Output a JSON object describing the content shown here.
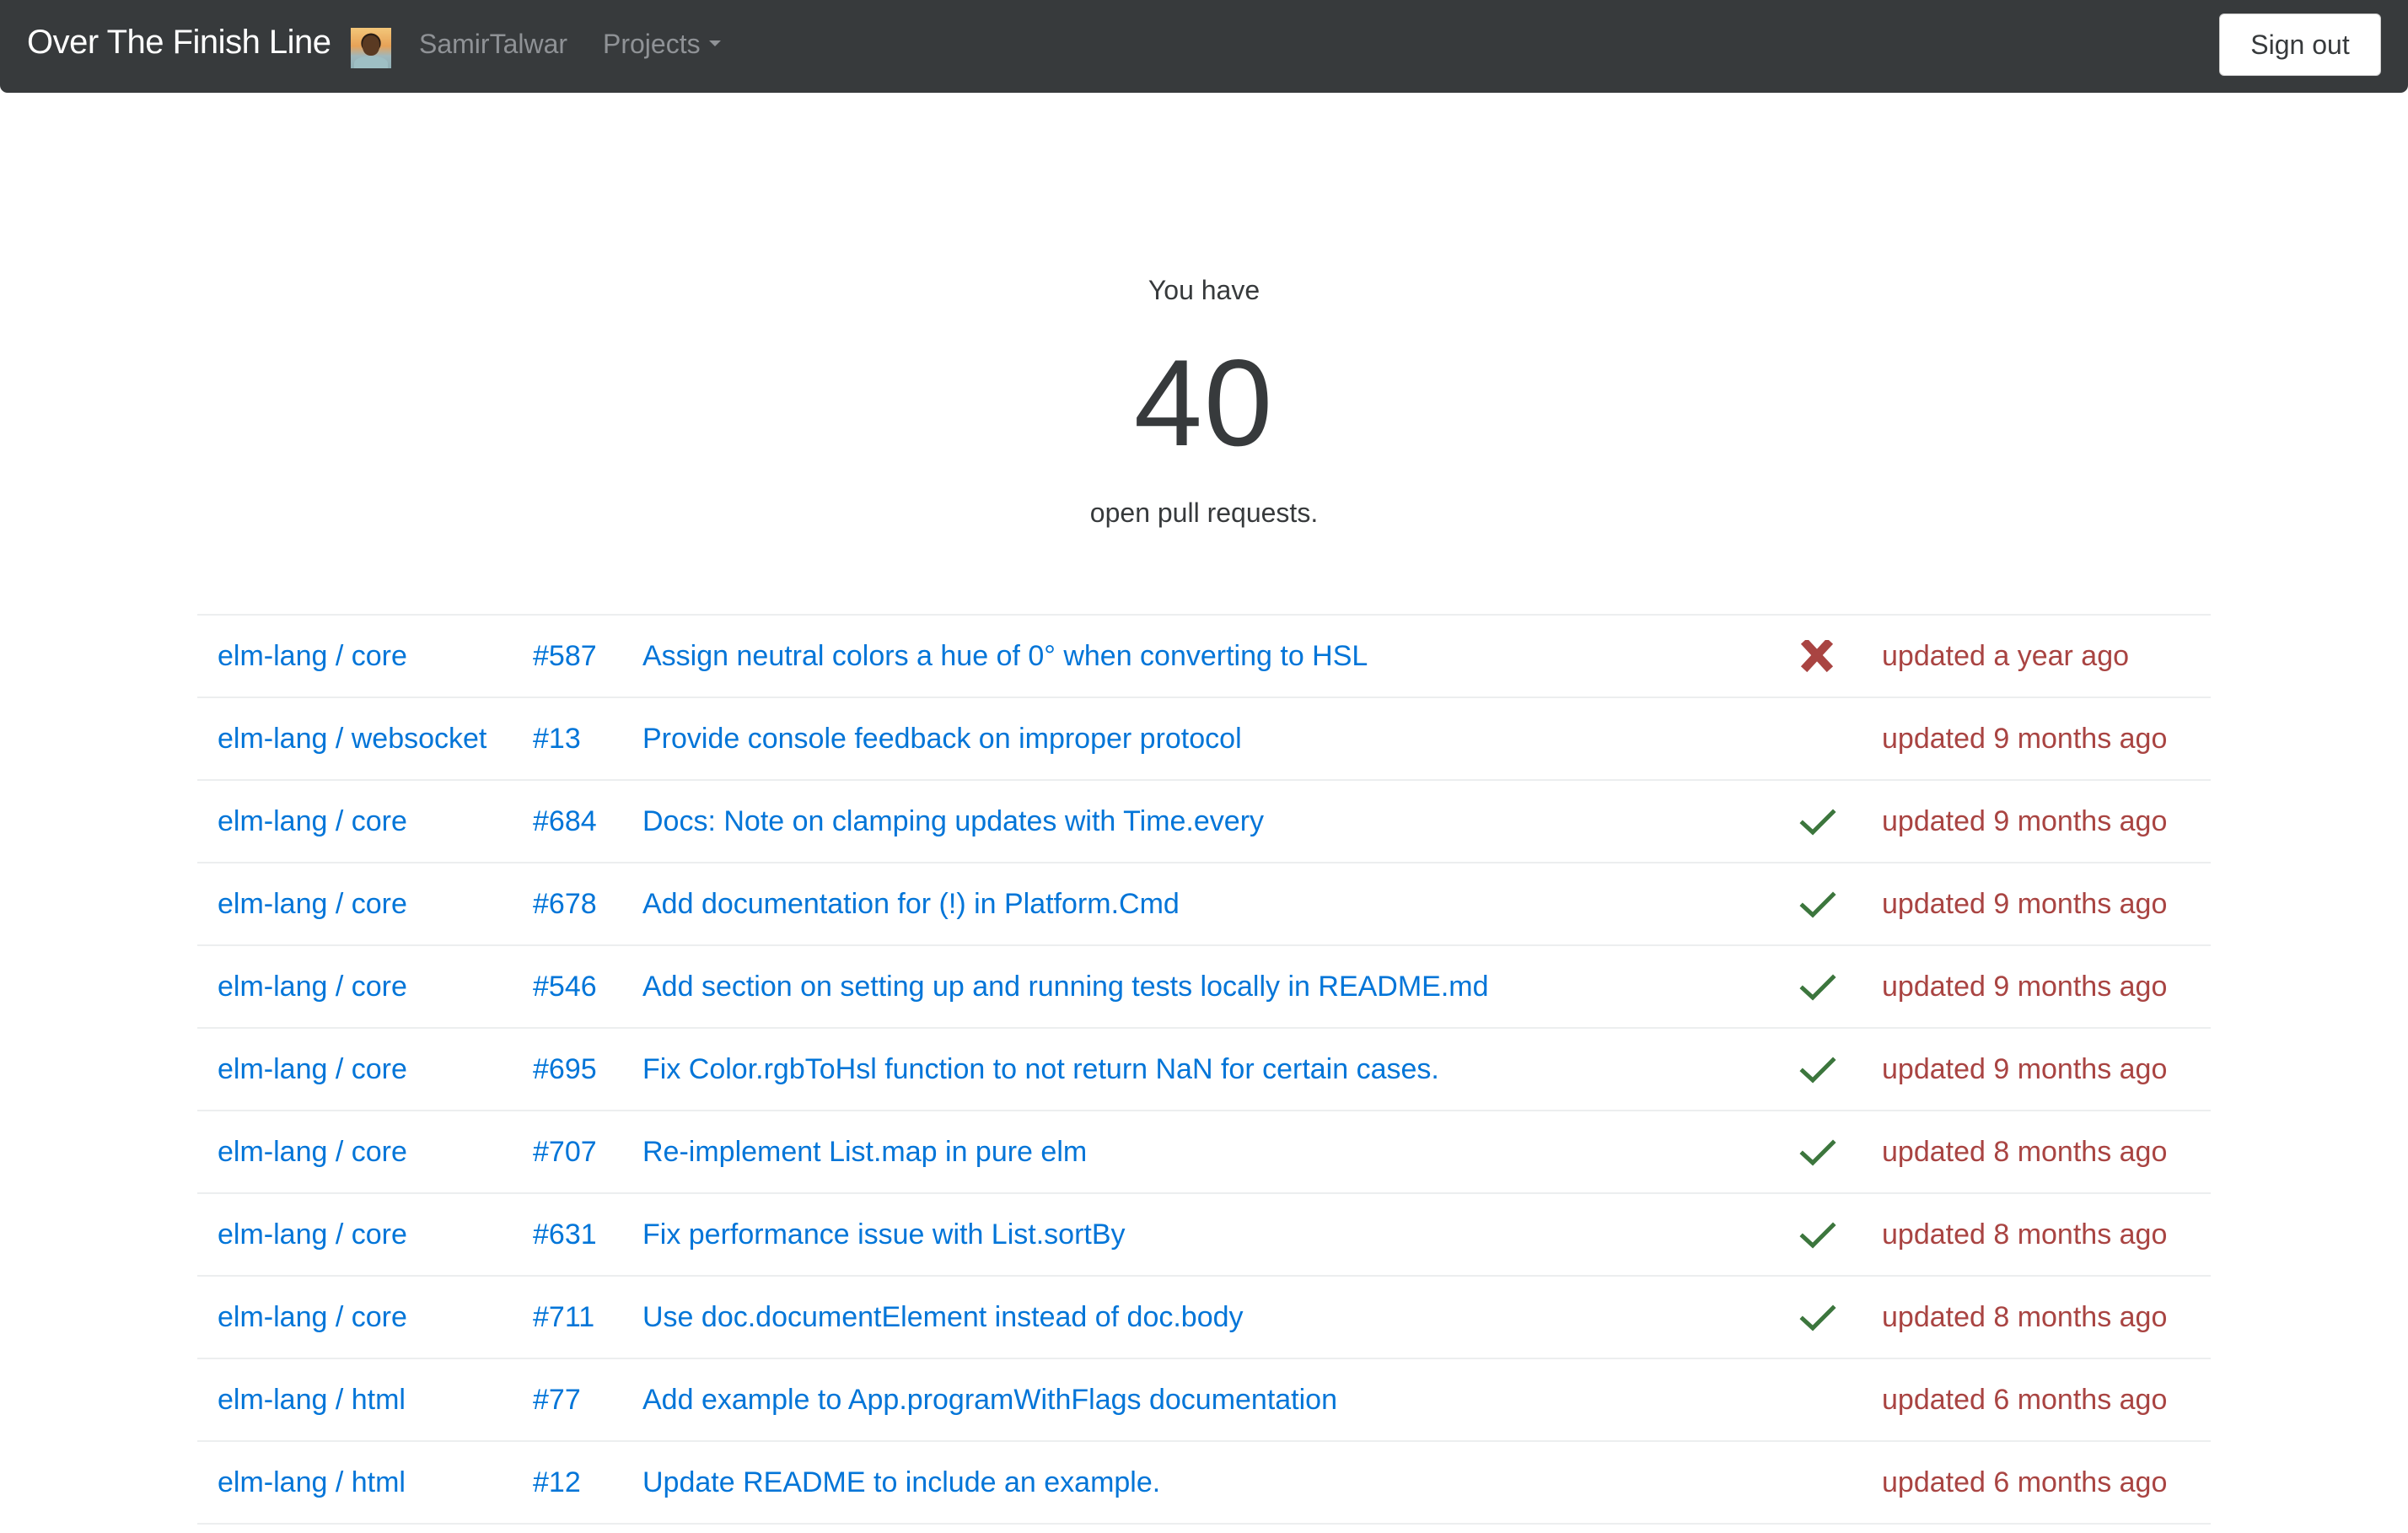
{
  "navbar": {
    "brand": "Over The Finish Line",
    "user": "SamirTalwar",
    "projects_label": "Projects",
    "sign_out_label": "Sign out"
  },
  "hero": {
    "prefix": "You have",
    "count": "40",
    "suffix": "open pull requests."
  },
  "colors": {
    "navbar_bg": "#373a3c",
    "link": "#0275d8",
    "time": "#a94442",
    "success": "#3c763d",
    "failure": "#a94442"
  },
  "pull_requests": [
    {
      "repo": "elm-lang / core",
      "number": "#587",
      "title": "Assign neutral colors a hue of 0° when converting to HSL",
      "status": "failure",
      "status_icon": "cross-icon",
      "updated": "updated a year ago"
    },
    {
      "repo": "elm-lang / websocket",
      "number": "#13",
      "title": "Provide console feedback on improper protocol",
      "status": "none",
      "status_icon": "",
      "updated": "updated 9 months ago"
    },
    {
      "repo": "elm-lang / core",
      "number": "#684",
      "title": "Docs: Note on clamping updates with Time.every",
      "status": "success",
      "status_icon": "check-icon",
      "updated": "updated 9 months ago"
    },
    {
      "repo": "elm-lang / core",
      "number": "#678",
      "title": "Add documentation for (!) in Platform.Cmd",
      "status": "success",
      "status_icon": "check-icon",
      "updated": "updated 9 months ago"
    },
    {
      "repo": "elm-lang / core",
      "number": "#546",
      "title": "Add section on setting up and running tests locally in README.md",
      "status": "success",
      "status_icon": "check-icon",
      "updated": "updated 9 months ago"
    },
    {
      "repo": "elm-lang / core",
      "number": "#695",
      "title": "Fix Color.rgbToHsl function to not return NaN for certain cases.",
      "status": "success",
      "status_icon": "check-icon",
      "updated": "updated 9 months ago"
    },
    {
      "repo": "elm-lang / core",
      "number": "#707",
      "title": "Re-implement List.map in pure elm",
      "status": "success",
      "status_icon": "check-icon",
      "updated": "updated 8 months ago"
    },
    {
      "repo": "elm-lang / core",
      "number": "#631",
      "title": "Fix performance issue with List.sortBy",
      "status": "success",
      "status_icon": "check-icon",
      "updated": "updated 8 months ago"
    },
    {
      "repo": "elm-lang / core",
      "number": "#711",
      "title": "Use doc.documentElement instead of doc.body",
      "status": "success",
      "status_icon": "check-icon",
      "updated": "updated 8 months ago"
    },
    {
      "repo": "elm-lang / html",
      "number": "#77",
      "title": "Add example to App.programWithFlags documentation",
      "status": "none",
      "status_icon": "",
      "updated": "updated 6 months ago"
    },
    {
      "repo": "elm-lang / html",
      "number": "#12",
      "title": "Update README to include an example.",
      "status": "none",
      "status_icon": "",
      "updated": "updated 6 months ago"
    }
  ]
}
